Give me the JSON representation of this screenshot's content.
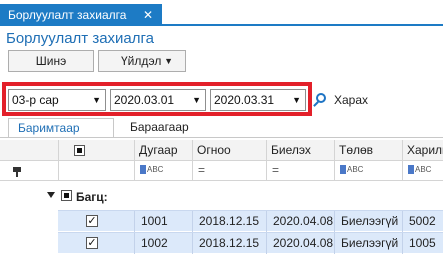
{
  "doc_tab": {
    "title": "Борлуулалт захиалга",
    "close": "✕"
  },
  "page": {
    "title": "Борлуулалт захиалга"
  },
  "toolbar": {
    "new_label": "Шинэ",
    "action_label": "Үйлдэл"
  },
  "filters": {
    "month": "03-р сар",
    "date_from": "2020.03.01",
    "date_to": "2020.03.31",
    "search_label": "Харах"
  },
  "view_tabs": {
    "active": "Баримтаар",
    "inactive": "Бараагаар"
  },
  "grid": {
    "columns": [
      "Дугаар",
      "Огноо",
      "Биелэх",
      "Төлөв",
      "Харилц"
    ],
    "filter_abc": "ABC",
    "filter_eq": "=",
    "group_label": "Багц:",
    "rows": [
      {
        "number": "1001",
        "date": "2018.12.15",
        "due": "2020.04.08",
        "status": "Биелээгүй",
        "partner": "5002"
      },
      {
        "number": "1002",
        "date": "2018.12.15",
        "due": "2020.04.08",
        "status": "Биелээгүй",
        "partner": "1005"
      }
    ]
  },
  "colors": {
    "accent": "#1d7bc5",
    "highlight": "#e3202a",
    "row_selected": "#dce9fa"
  }
}
